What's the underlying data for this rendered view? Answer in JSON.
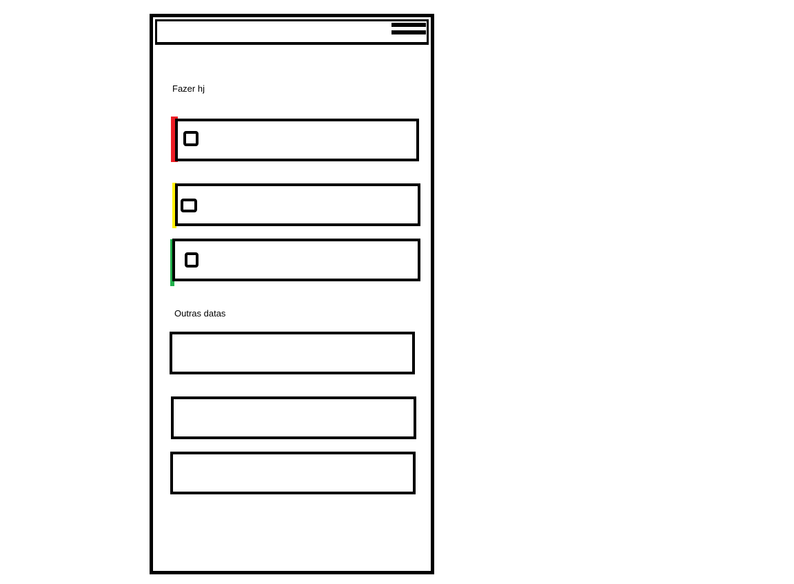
{
  "header": {
    "menu_icon": "hamburger-menu-icon"
  },
  "sections": {
    "today": {
      "title": "Fazer hj",
      "tasks": [
        {
          "priority": "high",
          "color": "#ed1c24",
          "checked": false
        },
        {
          "priority": "medium",
          "color": "#fff200",
          "checked": false
        },
        {
          "priority": "low",
          "color": "#22b14c",
          "checked": false
        }
      ]
    },
    "other": {
      "title": "Outras datas"
    }
  }
}
